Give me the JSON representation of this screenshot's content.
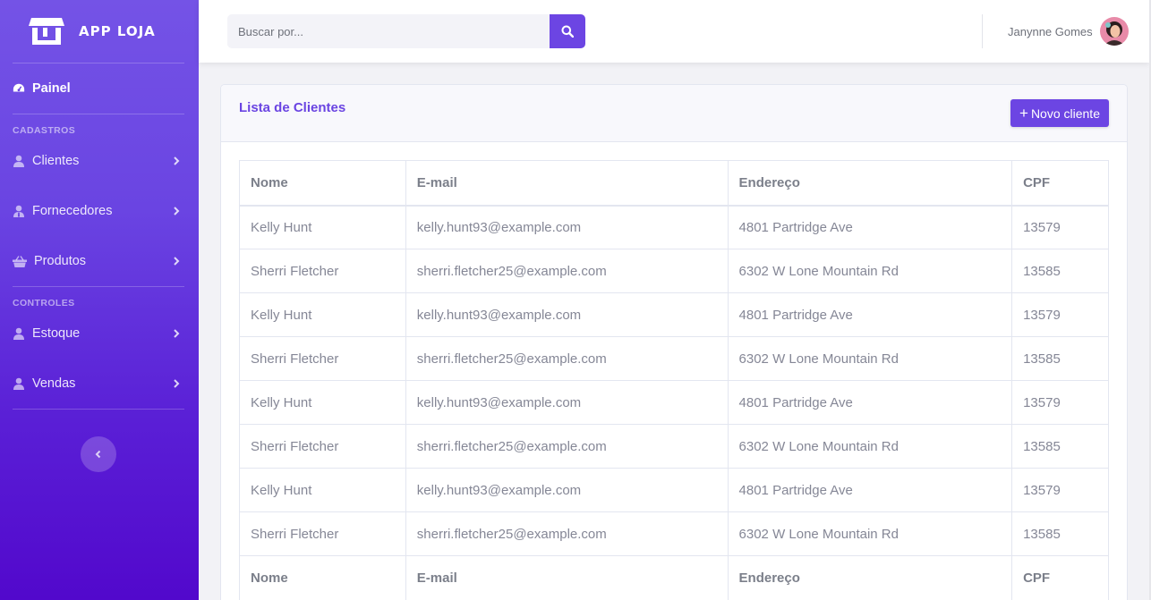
{
  "app": {
    "brand": "APP LOJA"
  },
  "sidebar": {
    "painel": "Painel",
    "sections": {
      "cadastros": "CADASTROS",
      "controles": "CONTROLES"
    },
    "items": [
      {
        "label": "Clientes",
        "icon": "user-icon"
      },
      {
        "label": "Fornecedores",
        "icon": "user-tie-icon"
      },
      {
        "label": "Produtos",
        "icon": "basket-icon"
      },
      {
        "label": "Estoque",
        "icon": "user-icon"
      },
      {
        "label": "Vendas",
        "icon": "user-icon"
      }
    ]
  },
  "search": {
    "placeholder": "Buscar por..."
  },
  "user": {
    "name": "Janynne Gomes"
  },
  "card": {
    "title": "Lista de Clientes",
    "new_button": "Novo cliente"
  },
  "table": {
    "headers": [
      "Nome",
      "E-mail",
      "Endereço",
      "CPF"
    ],
    "rows": [
      [
        "Kelly Hunt",
        "kelly.hunt93@example.com",
        "4801 Partridge Ave",
        "13579"
      ],
      [
        "Sherri Fletcher",
        "sherri.fletcher25@example.com",
        "6302 W Lone Mountain Rd",
        "13585"
      ],
      [
        "Kelly Hunt",
        "kelly.hunt93@example.com",
        "4801 Partridge Ave",
        "13579"
      ],
      [
        "Sherri Fletcher",
        "sherri.fletcher25@example.com",
        "6302 W Lone Mountain Rd",
        "13585"
      ],
      [
        "Kelly Hunt",
        "kelly.hunt93@example.com",
        "4801 Partridge Ave",
        "13579"
      ],
      [
        "Sherri Fletcher",
        "sherri.fletcher25@example.com",
        "6302 W Lone Mountain Rd",
        "13585"
      ],
      [
        "Kelly Hunt",
        "kelly.hunt93@example.com",
        "4801 Partridge Ave",
        "13579"
      ],
      [
        "Sherri Fletcher",
        "sherri.fletcher25@example.com",
        "6302 W Lone Mountain Rd",
        "13585"
      ]
    ],
    "footer": [
      "Nome",
      "E-mail",
      "Endereço",
      "CPF"
    ]
  },
  "colors": {
    "accent": "#6c45e3",
    "sidebar_top": "#7453e6",
    "sidebar_bottom": "#5208cc"
  }
}
